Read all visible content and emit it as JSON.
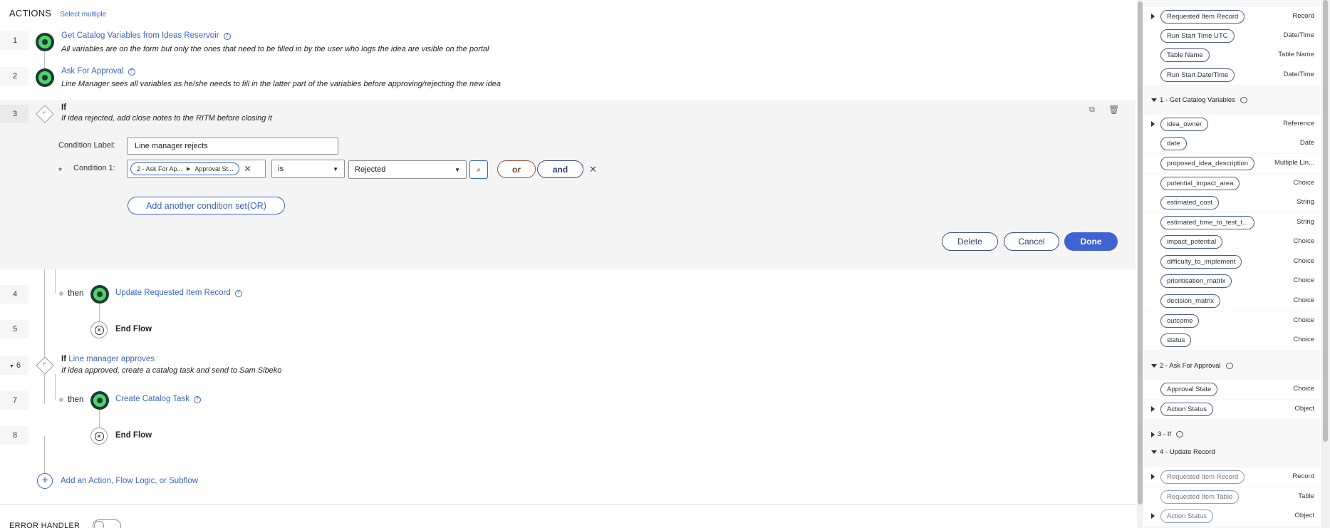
{
  "header": {
    "title": "ACTIONS",
    "select_multiple": "Select multiple"
  },
  "steps": [
    {
      "num": "1",
      "title": "Get Catalog Variables from Ideas Reservoir",
      "note": "All variables are on the form but only the ones that need to be filled in by the user who logs the idea are visible on the portal"
    },
    {
      "num": "2",
      "title": "Ask For Approval",
      "note": "Line Manager sees all variables as he/she needs to fill in the latter part of the variables before approving/rejecting the new idea"
    },
    {
      "num": "3",
      "title": "If",
      "note": "If idea rejected, add close notes to the RITM before closing it"
    },
    {
      "num": "4",
      "then": "then",
      "title": "Update Requested Item Record"
    },
    {
      "num": "5",
      "title": "End Flow"
    },
    {
      "num": "6",
      "prefix": "If",
      "title": "Line manager approves",
      "note": "If idea approved, create a catalog task and send to Sam Sibeko"
    },
    {
      "num": "7",
      "then": "then",
      "title": "Create Catalog Task"
    },
    {
      "num": "8",
      "title": "End Flow"
    }
  ],
  "if_panel": {
    "condition_label_text": "Condition Label:",
    "condition_label_value": "Line manager rejects",
    "required_mark": "*",
    "condition_1_text": "Condition 1:",
    "condition_pill": "2 - Ask For Ap...",
    "condition_pill_2": "Approval St...",
    "operator": "is",
    "value": "Rejected",
    "or": "or",
    "and": "and",
    "add_condition_set": "Add another condition set(OR)",
    "delete": "Delete",
    "cancel": "Cancel",
    "done": "Done"
  },
  "add_action": "Add an Action, Flow Logic, or Subflow",
  "error_handler": "ERROR HANDLER",
  "data_panel": {
    "trigger_rows": [
      {
        "label": "Requested Item Record",
        "type": "Record",
        "expand": true
      },
      {
        "label": "Run Start Time UTC",
        "type": "Date/Time"
      },
      {
        "label": "Table Name",
        "type": "Table Name"
      },
      {
        "label": "Run Start Date/Time",
        "type": "Date/Time"
      }
    ],
    "section1": "1 - Get Catalog Variables",
    "section1_rows": [
      {
        "label": "idea_owner",
        "type": "Reference",
        "expand": true
      },
      {
        "label": "date",
        "type": "Date"
      },
      {
        "label": "proposed_idea_description",
        "type": "Multiple Lin..."
      },
      {
        "label": "potential_impact_area",
        "type": "Choice"
      },
      {
        "label": "estimated_cost",
        "type": "String"
      },
      {
        "label": "estimated_time_to_test_t...",
        "type": "String"
      },
      {
        "label": "impact_potential",
        "type": "Choice"
      },
      {
        "label": "difficulty_to_implement",
        "type": "Choice"
      },
      {
        "label": "prioritisation_matrix",
        "type": "Choice"
      },
      {
        "label": "decision_matrix",
        "type": "Choice"
      },
      {
        "label": "outcome",
        "type": "Choice"
      },
      {
        "label": "status",
        "type": "Choice"
      }
    ],
    "section2": "2 - Ask For Approval",
    "section2_rows": [
      {
        "label": "Approval State",
        "type": "Choice"
      },
      {
        "label": "Action Status",
        "type": "Object",
        "expand": true
      }
    ],
    "section3": "3 - If",
    "section4": "4 - Update Record",
    "section4_rows": [
      {
        "label": "Requested Item Record",
        "type": "Record",
        "expand": true
      },
      {
        "label": "Requested Item Table",
        "type": "Table"
      },
      {
        "label": "Action Status",
        "type": "Object",
        "expand": true
      }
    ]
  }
}
